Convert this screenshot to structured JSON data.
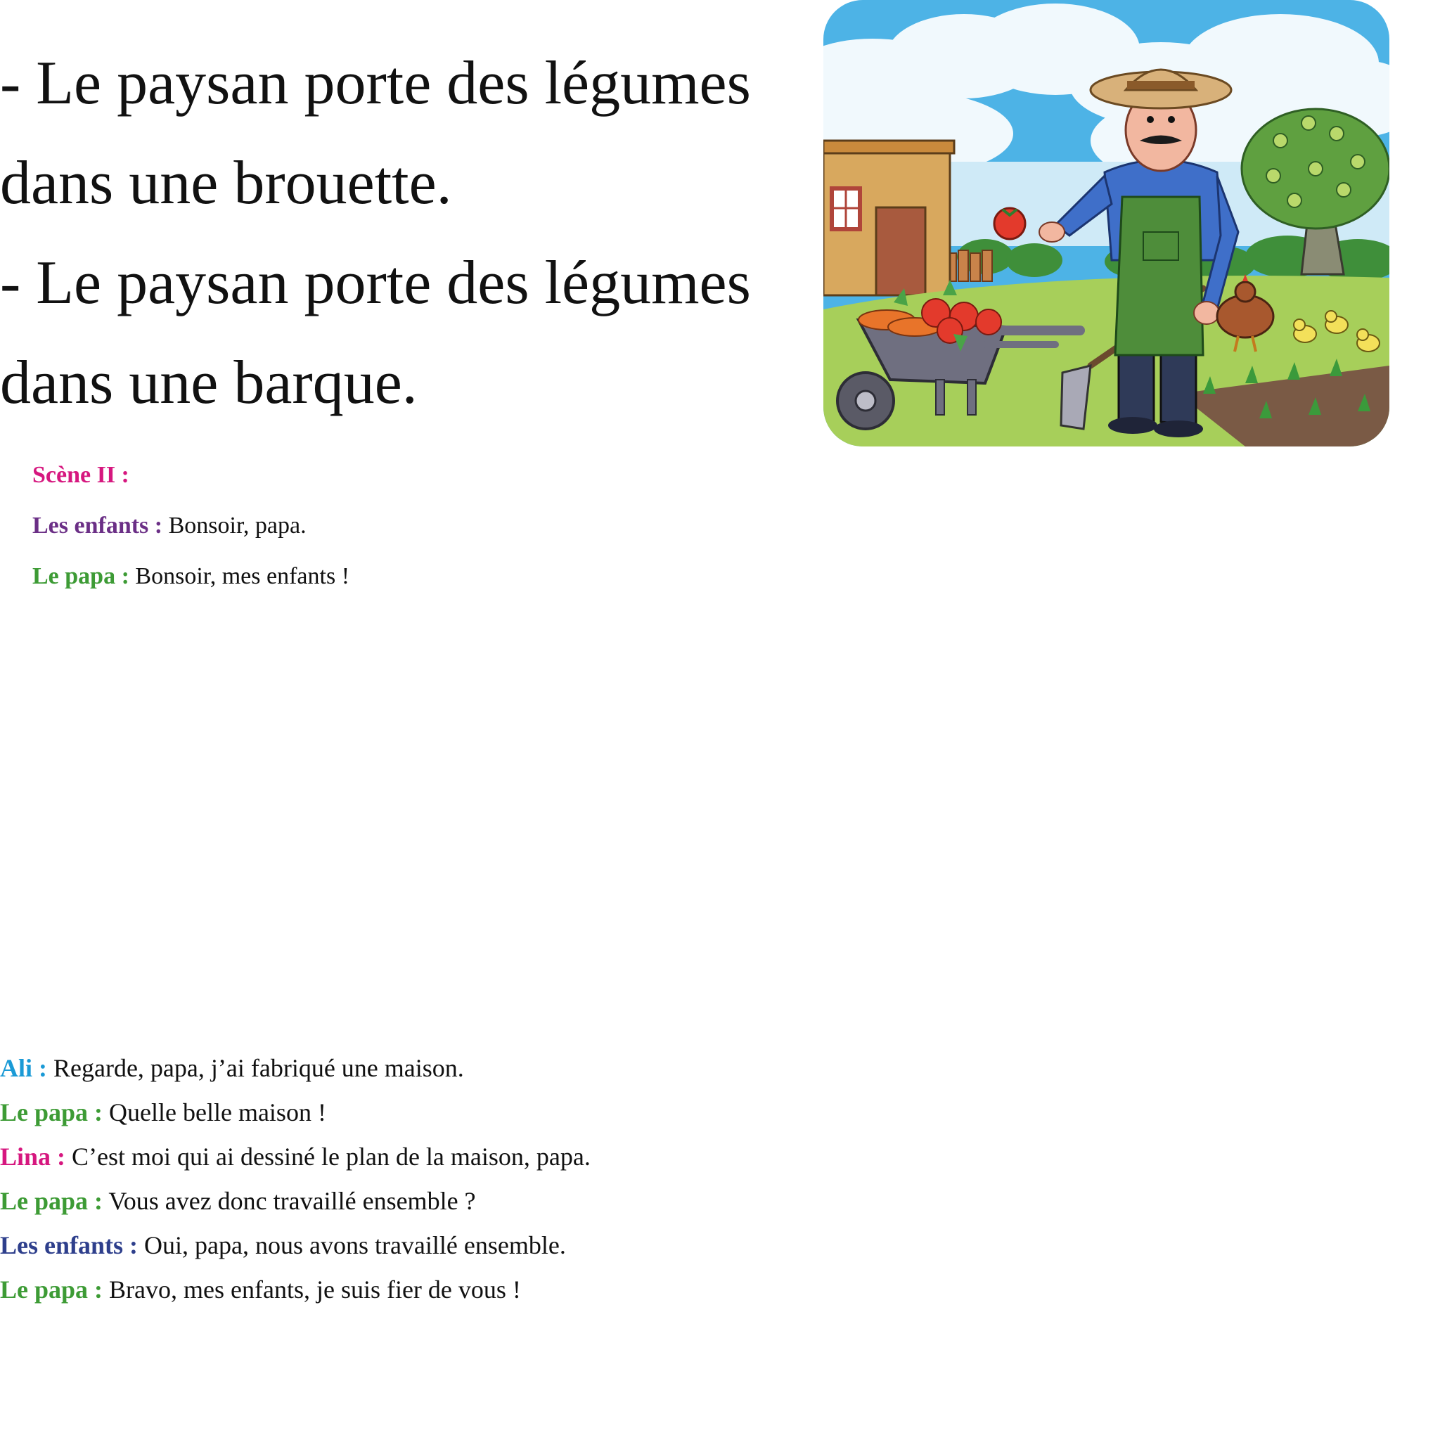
{
  "exercise": {
    "sentences": [
      "- Le paysan porte des légumes",
      "dans une brouette.",
      "- Le paysan porte des légumes",
      "dans une barque."
    ]
  },
  "illustration": {
    "description_icon": "farmer-with-wheelbarrow-illustration"
  },
  "scene": {
    "heading": "Scène II :",
    "lines": [
      {
        "speaker": "Les enfants :",
        "text": " Bonsoir, papa.",
        "color": "#6b2f86"
      },
      {
        "speaker": "Le papa :",
        "text": " Bonsoir, mes enfants !",
        "color": "#3d9b35"
      }
    ],
    "heading_color": "#d6177f"
  },
  "dialogue": {
    "lines": [
      {
        "speaker": "Ali :",
        "text": " Regarde, papa, j’ai fabriqué une maison.",
        "color": "#1a9ad6"
      },
      {
        "speaker": "Le papa :",
        "text": " Quelle belle maison !",
        "color": "#3d9b35"
      },
      {
        "speaker": "Lina :",
        "text": " C’est  moi qui ai dessiné le plan de la maison, papa.",
        "color": "#d6177f"
      },
      {
        "speaker": "Le papa :",
        "text": " Vous avez donc travaillé ensemble ?",
        "color": "#3d9b35"
      },
      {
        "speaker": "Les enfants :",
        "text": " Oui, papa, nous avons travaillé ensemble.",
        "color": "#2e3f8c"
      },
      {
        "speaker": "Le papa :",
        "text": " Bravo, mes enfants, je suis fier de vous !",
        "color": "#3d9b35"
      }
    ]
  }
}
